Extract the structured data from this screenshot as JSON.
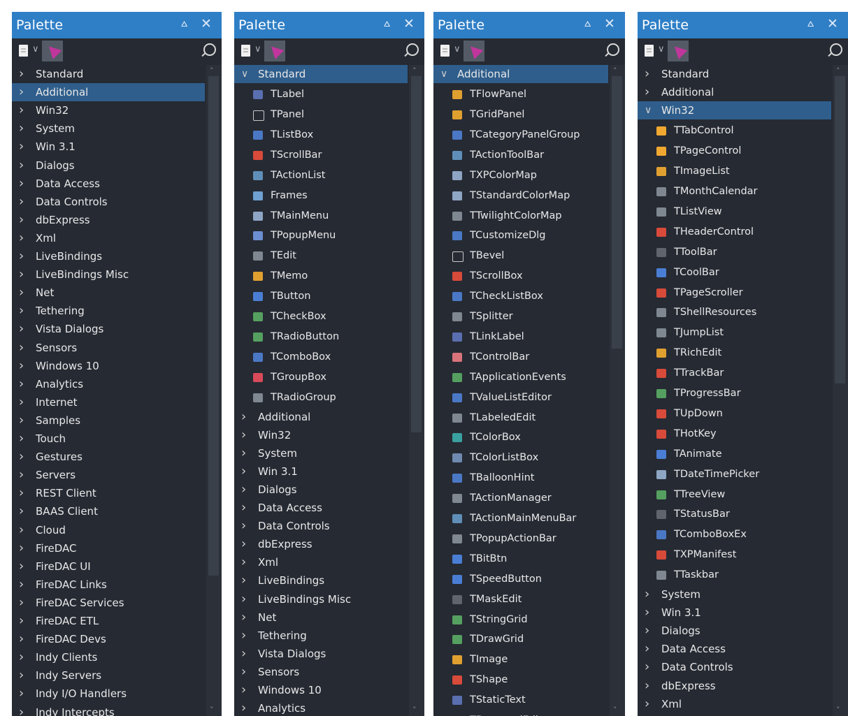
{
  "palettes": [
    {
      "title": "Palette",
      "pin_glyph": "⩟",
      "close_glyph": "✕",
      "categories": [
        "Standard",
        "Additional",
        "Win32",
        "System",
        "Win 3.1",
        "Dialogs",
        "Data Access",
        "Data Controls",
        "dbExpress",
        "Xml",
        "LiveBindings",
        "LiveBindings Misc",
        "Net",
        "Tethering",
        "Vista Dialogs",
        "Sensors",
        "Windows 10",
        "Analytics",
        "Internet",
        "Samples",
        "Touch",
        "Gestures",
        "Servers",
        "REST Client",
        "BAAS Client",
        "Cloud",
        "FireDAC",
        "FireDAC UI",
        "FireDAC Links",
        "FireDAC Services",
        "FireDAC ETL",
        "FireDAC Devs",
        "Indy Clients",
        "Indy Servers",
        "Indy I/O Handlers",
        "Indy Intercepts"
      ],
      "selected": "Additional"
    },
    {
      "title": "Palette",
      "pin_glyph": "⩟",
      "close_glyph": "✕",
      "expanded": "Standard",
      "components": [
        {
          "label": "TLabel",
          "icon": "label-icon",
          "color": "#5a6fb0"
        },
        {
          "label": "TPanel",
          "icon": "panel-icon",
          "color": "#262a33"
        },
        {
          "label": "TListBox",
          "icon": "listbox-icon",
          "color": "#4a78c4"
        },
        {
          "label": "TScrollBar",
          "icon": "scrollbar-icon",
          "color": "#d84a3a"
        },
        {
          "label": "TActionList",
          "icon": "actionlist-icon",
          "color": "#5f8fb8"
        },
        {
          "label": "Frames",
          "icon": "frames-icon",
          "color": "#6fa0d0"
        },
        {
          "label": "TMainMenu",
          "icon": "mainmenu-icon",
          "color": "#8ea6c4"
        },
        {
          "label": "TPopupMenu",
          "icon": "popupmenu-icon",
          "color": "#6b8fd0"
        },
        {
          "label": "TEdit",
          "icon": "edit-icon",
          "color": "#7f8790"
        },
        {
          "label": "TMemo",
          "icon": "memo-icon",
          "color": "#e0a030"
        },
        {
          "label": "TButton",
          "icon": "button-icon",
          "color": "#4a7ed4"
        },
        {
          "label": "TCheckBox",
          "icon": "checkbox-icon",
          "color": "#55a060"
        },
        {
          "label": "TRadioButton",
          "icon": "radiobutton-icon",
          "color": "#55a060"
        },
        {
          "label": "TComboBox",
          "icon": "combobox-icon",
          "color": "#4a78c4"
        },
        {
          "label": "TGroupBox",
          "icon": "groupbox-icon",
          "color": "#d84a5a"
        },
        {
          "label": "TRadioGroup",
          "icon": "radiogroup-icon",
          "color": "#7f8790"
        }
      ],
      "categories_after": [
        "Additional",
        "Win32",
        "System",
        "Win 3.1",
        "Dialogs",
        "Data Access",
        "Data Controls",
        "dbExpress",
        "Xml",
        "LiveBindings",
        "LiveBindings Misc",
        "Net",
        "Tethering",
        "Vista Dialogs",
        "Sensors",
        "Windows 10",
        "Analytics"
      ]
    },
    {
      "title": "Palette",
      "pin_glyph": "⩟",
      "close_glyph": "✕",
      "expanded": "Additional",
      "components": [
        {
          "label": "TFlowPanel",
          "icon": "flowpanel-icon",
          "color": "#e0a030"
        },
        {
          "label": "TGridPanel",
          "icon": "gridpanel-icon",
          "color": "#e0a030"
        },
        {
          "label": "TCategoryPanelGroup",
          "icon": "categorypanelgroup-icon",
          "color": "#4a78c4"
        },
        {
          "label": "TActionToolBar",
          "icon": "actiontoolbar-icon",
          "color": "#5f8fb8"
        },
        {
          "label": "TXPColorMap",
          "icon": "xpcolormap-icon",
          "color": "#8ea6c4"
        },
        {
          "label": "TStandardColorMap",
          "icon": "standardcolormap-icon",
          "color": "#8ea6c4"
        },
        {
          "label": "TTwilightColorMap",
          "icon": "twilightcolormap-icon",
          "color": "#7f8790"
        },
        {
          "label": "TCustomizeDlg",
          "icon": "customizedlg-icon",
          "color": "#4a78c4"
        },
        {
          "label": "TBevel",
          "icon": "bevel-icon",
          "color": "#262a33"
        },
        {
          "label": "TScrollBox",
          "icon": "scrollbox-icon",
          "color": "#d84a3a"
        },
        {
          "label": "TCheckListBox",
          "icon": "checklistbox-icon",
          "color": "#4a78c4"
        },
        {
          "label": "TSplitter",
          "icon": "splitter-icon",
          "color": "#7f8790"
        },
        {
          "label": "TLinkLabel",
          "icon": "linklabel-icon",
          "color": "#5a6fb0"
        },
        {
          "label": "TControlBar",
          "icon": "controlbar-icon",
          "color": "#d8737a"
        },
        {
          "label": "TApplicationEvents",
          "icon": "applicationevents-icon",
          "color": "#55a060"
        },
        {
          "label": "TValueListEditor",
          "icon": "valuelisteditor-icon",
          "color": "#4a78c4"
        },
        {
          "label": "TLabeledEdit",
          "icon": "labelededit-icon",
          "color": "#7f8790"
        },
        {
          "label": "TColorBox",
          "icon": "colorbox-icon",
          "color": "#3aa0a0"
        },
        {
          "label": "TColorListBox",
          "icon": "colorlistbox-icon",
          "color": "#6f8ab0"
        },
        {
          "label": "TBalloonHint",
          "icon": "balloonhint-icon",
          "color": "#4a78c4"
        },
        {
          "label": "TActionManager",
          "icon": "actionmanager-icon",
          "color": "#7f8790"
        },
        {
          "label": "TActionMainMenuBar",
          "icon": "actionmainmenubar-icon",
          "color": "#5f8fb8"
        },
        {
          "label": "TPopupActionBar",
          "icon": "popupactionbar-icon",
          "color": "#7f8790"
        },
        {
          "label": "TBitBtn",
          "icon": "bitbtn-icon",
          "color": "#4a7ed4"
        },
        {
          "label": "TSpeedButton",
          "icon": "speedbutton-icon",
          "color": "#4a7ed4"
        },
        {
          "label": "TMaskEdit",
          "icon": "maskedit-icon",
          "color": "#5f646d"
        },
        {
          "label": "TStringGrid",
          "icon": "stringgrid-icon",
          "color": "#55a060"
        },
        {
          "label": "TDrawGrid",
          "icon": "drawgrid-icon",
          "color": "#55a060"
        },
        {
          "label": "TImage",
          "icon": "image-icon",
          "color": "#e0a030"
        },
        {
          "label": "TShape",
          "icon": "shape-icon",
          "color": "#d84a3a"
        },
        {
          "label": "TStaticText",
          "icon": "statictext-icon",
          "color": "#5a6fb0"
        },
        {
          "label": "TButtonedEdit",
          "icon": "buttonededit-icon",
          "color": "#7f8790"
        }
      ]
    },
    {
      "title": "Palette",
      "pin_glyph": "⩟",
      "close_glyph": "✕",
      "categories_before": [
        "Standard",
        "Additional"
      ],
      "expanded": "Win32",
      "components": [
        {
          "label": "TTabControl",
          "icon": "tabcontrol-icon",
          "color": "#f0a830"
        },
        {
          "label": "TPageControl",
          "icon": "pagecontrol-icon",
          "color": "#f0a830"
        },
        {
          "label": "TImageList",
          "icon": "imagelist-icon",
          "color": "#e0a030"
        },
        {
          "label": "TMonthCalendar",
          "icon": "monthcalendar-icon",
          "color": "#7f8790"
        },
        {
          "label": "TListView",
          "icon": "listview-icon",
          "color": "#7f8790"
        },
        {
          "label": "THeaderControl",
          "icon": "headercontrol-icon",
          "color": "#d84a3a"
        },
        {
          "label": "TToolBar",
          "icon": "toolbar-icon",
          "color": "#5f646d"
        },
        {
          "label": "TCoolBar",
          "icon": "coolbar-icon",
          "color": "#4a7ed4"
        },
        {
          "label": "TPageScroller",
          "icon": "pagescroller-icon",
          "color": "#d84a3a"
        },
        {
          "label": "TShellResources",
          "icon": "shellresources-icon",
          "color": "#7f8790"
        },
        {
          "label": "TJumpList",
          "icon": "jumplist-icon",
          "color": "#7f8790"
        },
        {
          "label": "TRichEdit",
          "icon": "richedit-icon",
          "color": "#e0a030"
        },
        {
          "label": "TTrackBar",
          "icon": "trackbar-icon",
          "color": "#d84a3a"
        },
        {
          "label": "TProgressBar",
          "icon": "progressbar-icon",
          "color": "#55a060"
        },
        {
          "label": "TUpDown",
          "icon": "updown-icon",
          "color": "#d84a3a"
        },
        {
          "label": "THotKey",
          "icon": "hotkey-icon",
          "color": "#d84a3a"
        },
        {
          "label": "TAnimate",
          "icon": "animate-icon",
          "color": "#4a7ed4"
        },
        {
          "label": "TDateTimePicker",
          "icon": "datetimepicker-icon",
          "color": "#8ea6c4"
        },
        {
          "label": "TTreeView",
          "icon": "treeview-icon",
          "color": "#55a060"
        },
        {
          "label": "TStatusBar",
          "icon": "statusbar-icon",
          "color": "#5f646d"
        },
        {
          "label": "TComboBoxEx",
          "icon": "comboboxex-icon",
          "color": "#4a78c4"
        },
        {
          "label": "TXPManifest",
          "icon": "xpmanifest-icon",
          "color": "#d84a3a"
        },
        {
          "label": "TTaskbar",
          "icon": "taskbar-icon",
          "color": "#7f8790"
        }
      ],
      "categories_after": [
        "System",
        "Win 3.1",
        "Dialogs",
        "Data Access",
        "Data Controls",
        "dbExpress",
        "Xml"
      ]
    }
  ]
}
